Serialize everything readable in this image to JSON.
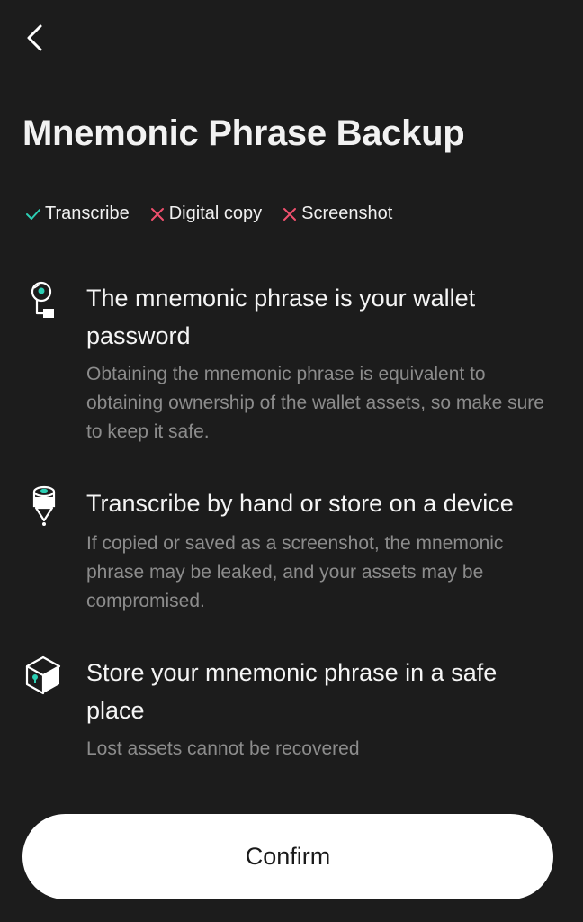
{
  "header": {
    "back_icon": "chevron-left-icon"
  },
  "title": "Mnemonic Phrase Backup",
  "rules": [
    {
      "label": "Transcribe",
      "status": "allowed",
      "icon": "check-icon",
      "color": "#2ccfb4"
    },
    {
      "label": "Digital copy",
      "status": "forbidden",
      "icon": "x-icon",
      "color": "#f0506e"
    },
    {
      "label": "Screenshot",
      "status": "forbidden",
      "icon": "x-icon",
      "color": "#f0506e"
    }
  ],
  "sections": [
    {
      "icon": "key-lock-icon",
      "heading": "The mnemonic phrase is your wallet password",
      "description": "Obtaining the mnemonic phrase is equivalent to obtaining ownership of the wallet assets, so make sure to keep it safe."
    },
    {
      "icon": "pen-icon",
      "heading": "Transcribe by hand or store on a device",
      "description": "If copied or saved as a screenshot, the mnemonic phrase may be leaked, and your assets may be compromised."
    },
    {
      "icon": "safe-box-icon",
      "heading": "Store your mnemonic phrase in a safe place",
      "description": "Lost assets cannot be recovered"
    }
  ],
  "confirm_label": "Confirm",
  "colors": {
    "background": "#1c1c1c",
    "accent_teal": "#2ccfb4",
    "forbidden_red": "#f0506e",
    "description_gray": "#8c8c8c"
  }
}
